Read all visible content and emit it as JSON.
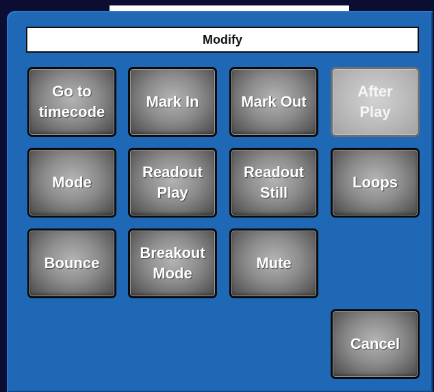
{
  "dialog": {
    "title": "Modify"
  },
  "buttons": {
    "go_to_timecode": "Go to\ntimecode",
    "mark_in": "Mark In",
    "mark_out": "Mark Out",
    "after_play": "After\nPlay",
    "mode": "Mode",
    "readout_play": "Readout\nPlay",
    "readout_still": "Readout\nStill",
    "loops": "Loops",
    "bounce": "Bounce",
    "breakout_mode": "Breakout\nMode",
    "mute": "Mute",
    "cancel": "Cancel"
  },
  "state": {
    "after_play_enabled": false
  },
  "colors": {
    "panel_blue": "#1f68b6",
    "button_gray": "#8c8c8c",
    "button_disabled_gray": "#bcbcbc",
    "title_bar_bg": "#ffffff"
  }
}
